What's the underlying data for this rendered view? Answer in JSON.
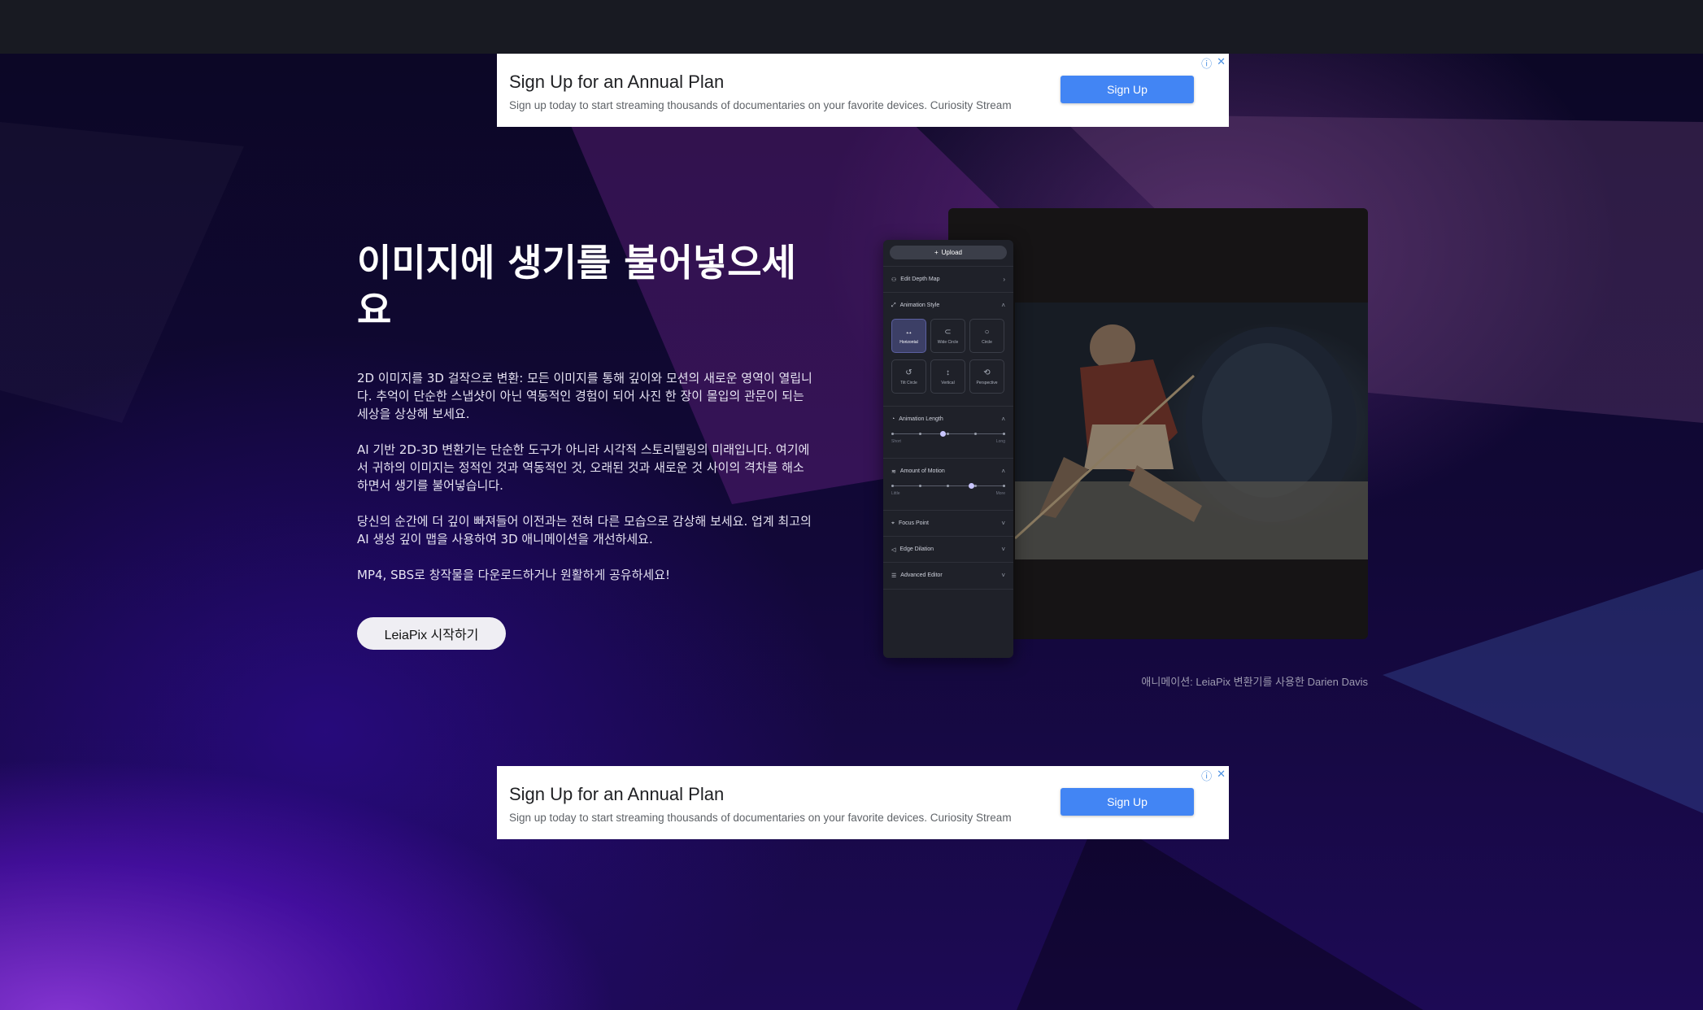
{
  "ads": [
    {
      "title": "Sign Up for an Annual Plan",
      "subtitle": "Sign up today to start streaming thousands of documentaries on your favorite devices. Curiosity Stream",
      "button": "Sign Up",
      "icons": [
        "info-icon",
        "close-icon"
      ]
    },
    {
      "title": "Sign Up for an Annual Plan",
      "subtitle": "Sign up today to start streaming thousands of documentaries on your favorite devices. Curiosity Stream",
      "button": "Sign Up",
      "icons": [
        "info-icon",
        "close-icon"
      ]
    }
  ],
  "hero": {
    "headline": "이미지에 생기를 불어넣으세요",
    "paragraphs": [
      "2D 이미지를 3D 걸작으로 변환: 모든 이미지를 통해 깊이와 모션의 새로운 영역이 열립니다. 추억이 단순한 스냅샷이 아닌 역동적인 경험이 되어 사진 한 장이 몰입의 관문이 되는 세상을 상상해 보세요.",
      "AI 기반 2D-3D 변환기는 단순한 도구가 아니라 시각적 스토리텔링의 미래입니다. 여기에서 귀하의 이미지는 정적인 것과 역동적인 것, 오래된 것과 새로운 것 사이의 격차를 해소하면서 생기를 불어넣습니다.",
      "당신의 순간에 더 깊이 빠져들어 이전과는 전혀 다른 모습으로 감상해 보세요. 업계 최고의 AI 생성 깊이 맵을 사용하여 3D 애니메이션을 개선하세요.",
      "MP4, SBS로 창작물을 다운로드하거나 원활하게 공유하세요!"
    ],
    "cta": "LeiaPix 시작하기"
  },
  "panel": {
    "upload": "Upload",
    "edit_depth_map": "Edit Depth Map",
    "animation_style": "Animation Style",
    "styles": [
      {
        "label": "Horizontal",
        "icon": "arrows-horizontal-icon",
        "active": true
      },
      {
        "label": "Wide Circle",
        "icon": "wide-circle-icon",
        "active": false
      },
      {
        "label": "Circle",
        "icon": "circle-icon",
        "active": false
      },
      {
        "label": "Tilt Circle",
        "icon": "tilt-circle-icon",
        "active": false
      },
      {
        "label": "Vertical",
        "icon": "arrows-vertical-icon",
        "active": false
      },
      {
        "label": "Perspective",
        "icon": "perspective-icon",
        "active": false
      }
    ],
    "animation_length": "Animation Length",
    "length_min": "Short",
    "length_max": "Long",
    "length_value": 0.45,
    "amount_of_motion": "Amount of Motion",
    "motion_min": "Little",
    "motion_max": "More",
    "motion_value": 0.7,
    "focus_point": "Focus Point",
    "edge_dilation": "Edge Dilation",
    "advanced_editor": "Advanced Editor"
  },
  "caption": "애니메이션: LeiaPix 변환기를 사용한 Darien Davis",
  "colors": {
    "ad_button": "#4285f4",
    "panel_bg": "#1f2129",
    "active_tile": "#3c3f66"
  }
}
